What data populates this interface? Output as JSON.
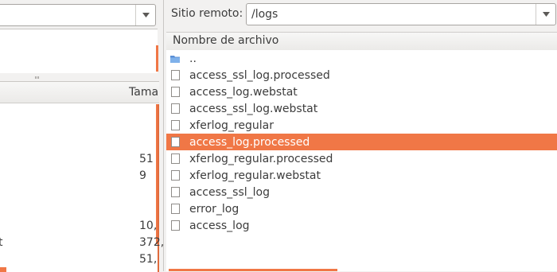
{
  "left_pane": {
    "local_site_value": "",
    "list_header": {
      "size_col": "Tamaño"
    },
    "rows": [
      {
        "name": "",
        "size": ""
      },
      {
        "name": "",
        "size": ""
      },
      {
        "name": "",
        "size": ""
      },
      {
        "name": "",
        "size": "51"
      },
      {
        "name": "",
        "size": "9"
      },
      {
        "name": "",
        "size": ""
      },
      {
        "name": "",
        "size": ""
      },
      {
        "name": "",
        "size": "10,"
      },
      {
        "name": "t",
        "size": "372,"
      },
      {
        "name": "",
        "size": "51,"
      }
    ]
  },
  "right_pane": {
    "remote_label": "Sitio remoto:",
    "remote_path": "/logs",
    "header": {
      "filename_col": "Nombre de archivo"
    },
    "files": [
      {
        "name": "..",
        "icon": "folder-icon",
        "selected": false
      },
      {
        "name": "access_ssl_log.processed",
        "icon": "file-icon",
        "selected": false
      },
      {
        "name": "access_log.webstat",
        "icon": "file-icon",
        "selected": false
      },
      {
        "name": "access_ssl_log.webstat",
        "icon": "file-icon",
        "selected": false
      },
      {
        "name": "xferlog_regular",
        "icon": "file-icon",
        "selected": false
      },
      {
        "name": "access_log.processed",
        "icon": "file-icon",
        "selected": true
      },
      {
        "name": "xferlog_regular.processed",
        "icon": "file-icon",
        "selected": false
      },
      {
        "name": "xferlog_regular.webstat",
        "icon": "file-icon",
        "selected": false
      },
      {
        "name": "access_ssl_log",
        "icon": "file-icon",
        "selected": false
      },
      {
        "name": "error_log",
        "icon": "file-icon",
        "selected": false
      },
      {
        "name": "access_log",
        "icon": "file-icon",
        "selected": false
      }
    ]
  },
  "colors": {
    "accent": "#f07746",
    "selection_text": "#ffffff"
  }
}
